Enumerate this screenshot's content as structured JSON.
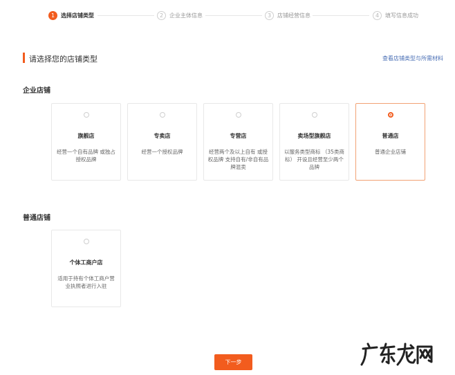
{
  "stepper": {
    "steps": [
      {
        "num": "1",
        "label": "选择店铺类型",
        "state": "active"
      },
      {
        "num": "2",
        "label": "企业主体信息",
        "state": "idle"
      },
      {
        "num": "3",
        "label": "店铺经营信息",
        "state": "idle"
      },
      {
        "num": "4",
        "label": "填写信息成功",
        "state": "idle"
      }
    ]
  },
  "section": {
    "title": "请选择您的店铺类型",
    "link": "查看店铺类型与所需材料"
  },
  "groups": {
    "enterprise": {
      "title": "企业店铺",
      "cards": [
        {
          "name": "旗舰店",
          "desc": "经营一个自有品牌 或独占授权品牌",
          "selected": false
        },
        {
          "name": "专卖店",
          "desc": "经营一个授权品牌",
          "selected": false
        },
        {
          "name": "专营店",
          "desc": "经营两个及以上自有 或授权品牌 支持自有/非自有品牌混卖",
          "selected": false
        },
        {
          "name": "卖场型旗舰店",
          "desc": "以服务类型商标 （35类商标） 开设且经营至少两个品牌",
          "selected": false
        },
        {
          "name": "普通店",
          "desc": "普通企业店铺",
          "selected": true
        }
      ]
    },
    "normal": {
      "title": "普通店铺",
      "cards": [
        {
          "name": "个体工商户店",
          "desc": "适用于持有个体工商户营业执照者进行入驻",
          "selected": false
        }
      ]
    }
  },
  "next_button": "下一步",
  "watermark": "广东龙网",
  "colors": {
    "accent": "#f25c1e",
    "link": "#4a6fb5"
  }
}
